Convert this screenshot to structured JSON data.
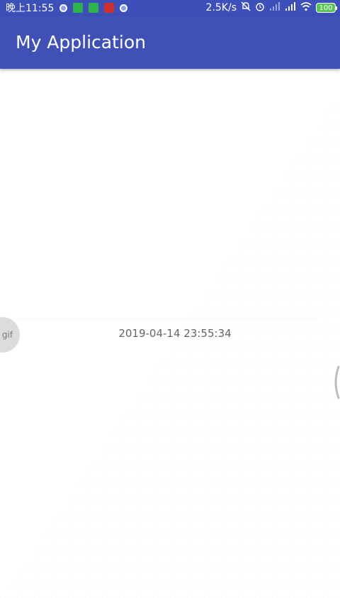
{
  "status_bar": {
    "time": "晚上11:55",
    "network_speed": "2.5K/s",
    "battery_level": "100",
    "icons": [
      "notification-dot-icon",
      "app-badge-green-icon",
      "app-badge-green-icon",
      "app-badge-red-icon",
      "notification-dot-icon",
      "mute-icon",
      "alarm-icon",
      "signal-weak-icon",
      "signal-icon",
      "wifi-icon",
      "battery-icon"
    ]
  },
  "app_bar": {
    "title": "My Application",
    "color": "#3f51b5"
  },
  "content": {
    "badge_label": "gif",
    "timestamp": "2019-04-14 23:55:34"
  }
}
